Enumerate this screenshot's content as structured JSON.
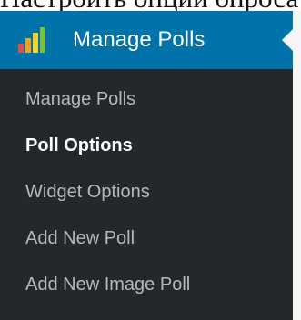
{
  "caption": "Настроить опции опроса",
  "menu": {
    "title": "Manage Polls",
    "logo_icon": "poll-bar-chart-icon",
    "items": [
      {
        "label": "Manage Polls",
        "current": false
      },
      {
        "label": "Poll Options",
        "current": true
      },
      {
        "label": "Widget Options",
        "current": false
      },
      {
        "label": "Add New Poll",
        "current": false
      },
      {
        "label": "Add New Image Poll",
        "current": false
      }
    ]
  },
  "colors": {
    "header_bg": "#0073aa",
    "menu_bg": "#23282d",
    "item_text": "#b4b9be",
    "current_text": "#ffffff",
    "logo_red": "#e14d43",
    "logo_orange": "#f7a21b",
    "logo_yellow": "#f5d327",
    "logo_green": "#7ac142"
  }
}
